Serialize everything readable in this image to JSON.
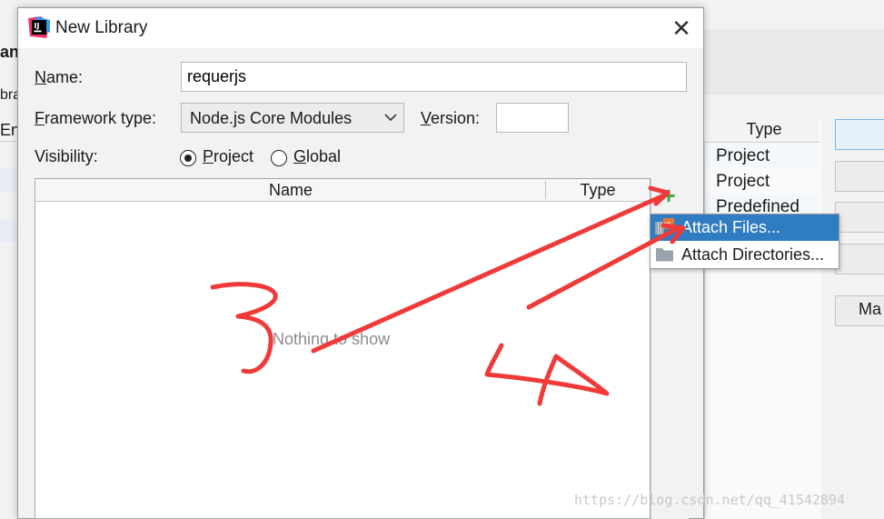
{
  "background": {
    "left_fragments": {
      "line1": "ang",
      "line2": "bra",
      "line3": "En"
    },
    "table": {
      "column_header": "Type",
      "rows": [
        "Project",
        "Project",
        "Predefined"
      ]
    },
    "button_label": "Ma"
  },
  "dialog": {
    "title": "New Library",
    "close_icon": "close-icon",
    "name_label_first": "N",
    "name_label_rest": "ame:",
    "name_value": "requerjs",
    "framework_label_first": "F",
    "framework_label_rest": "ramework type:",
    "framework_value": "Node.js Core Modules",
    "version_label_first": "V",
    "version_label_rest": "ersion:",
    "version_value": "",
    "visibility_label": "Visibility:",
    "visibility_options": [
      {
        "first": "P",
        "rest": "roject",
        "selected": true
      },
      {
        "first": "G",
        "rest": "lobal",
        "selected": false
      }
    ],
    "table": {
      "columns": [
        "Name",
        "Type"
      ],
      "empty_text": "Nothing to show"
    },
    "add_icon": "plus-icon",
    "popup_menu": [
      {
        "label": "Attach Files...",
        "icon": "js-file-icon",
        "selected": true
      },
      {
        "label": "Attach Directories...",
        "icon": "folder-icon",
        "selected": false
      }
    ]
  },
  "annotations": {
    "numbers": [
      "3",
      "4"
    ],
    "color": "#f03a3a"
  },
  "watermark": "https://blog.csdn.net/qq_41542894",
  "colors": {
    "selection": "#2f7cc2",
    "plus": "#3aa83a",
    "annotation": "#f03a3a"
  }
}
